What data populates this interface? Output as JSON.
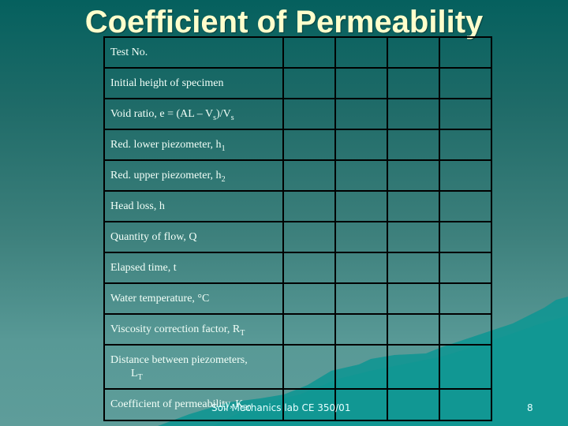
{
  "slide": {
    "title": "Coefficient of Permeability",
    "footer_text": "Soil Mechanics lab CE 350/01",
    "page_number": "8",
    "colors": {
      "title": "#ffffcc",
      "text": "#f2fff8",
      "grid_lines": "#000000",
      "background_top": "#05605e",
      "background_bottom": "#5e9d9a",
      "mountain": "#12928f"
    }
  },
  "table": {
    "rows": [
      {
        "label": "Test No.",
        "sub": "",
        "values": [
          "",
          "",
          "",
          ""
        ]
      },
      {
        "label": "Initial height of specimen",
        "sub": "",
        "values": [
          "",
          "",
          "",
          ""
        ]
      },
      {
        "label_html_parts": [
          "Void ratio, e = (AL – V",
          "s",
          ")/V",
          "s"
        ],
        "values": [
          "",
          "",
          "",
          ""
        ]
      },
      {
        "label": "Red. lower piezometer, h",
        "sub": "1",
        "values": [
          "",
          "",
          "",
          ""
        ]
      },
      {
        "label": "Red. upper piezometer, h",
        "sub": "2",
        "values": [
          "",
          "",
          "",
          ""
        ]
      },
      {
        "label": "Head loss, h",
        "sub": "",
        "values": [
          "",
          "",
          "",
          ""
        ]
      },
      {
        "label": "Quantity of flow, Q",
        "sub": "",
        "values": [
          "",
          "",
          "",
          ""
        ]
      },
      {
        "label": "Elapsed time, t",
        "sub": "",
        "values": [
          "",
          "",
          "",
          ""
        ]
      },
      {
        "label": "Water temperature, °C",
        "sub": "",
        "values": [
          "",
          "",
          "",
          ""
        ]
      },
      {
        "label": "Viscosity correction factor, R",
        "sub": "T",
        "values": [
          "",
          "",
          "",
          ""
        ]
      },
      {
        "label": "Distance between piezometers,",
        "label_line2": "L",
        "sub": "T",
        "values": [
          "",
          "",
          "",
          ""
        ]
      },
      {
        "label": "Coefficient of permeability, K",
        "sub": "20",
        "values": [
          "",
          "",
          "",
          ""
        ]
      }
    ]
  }
}
